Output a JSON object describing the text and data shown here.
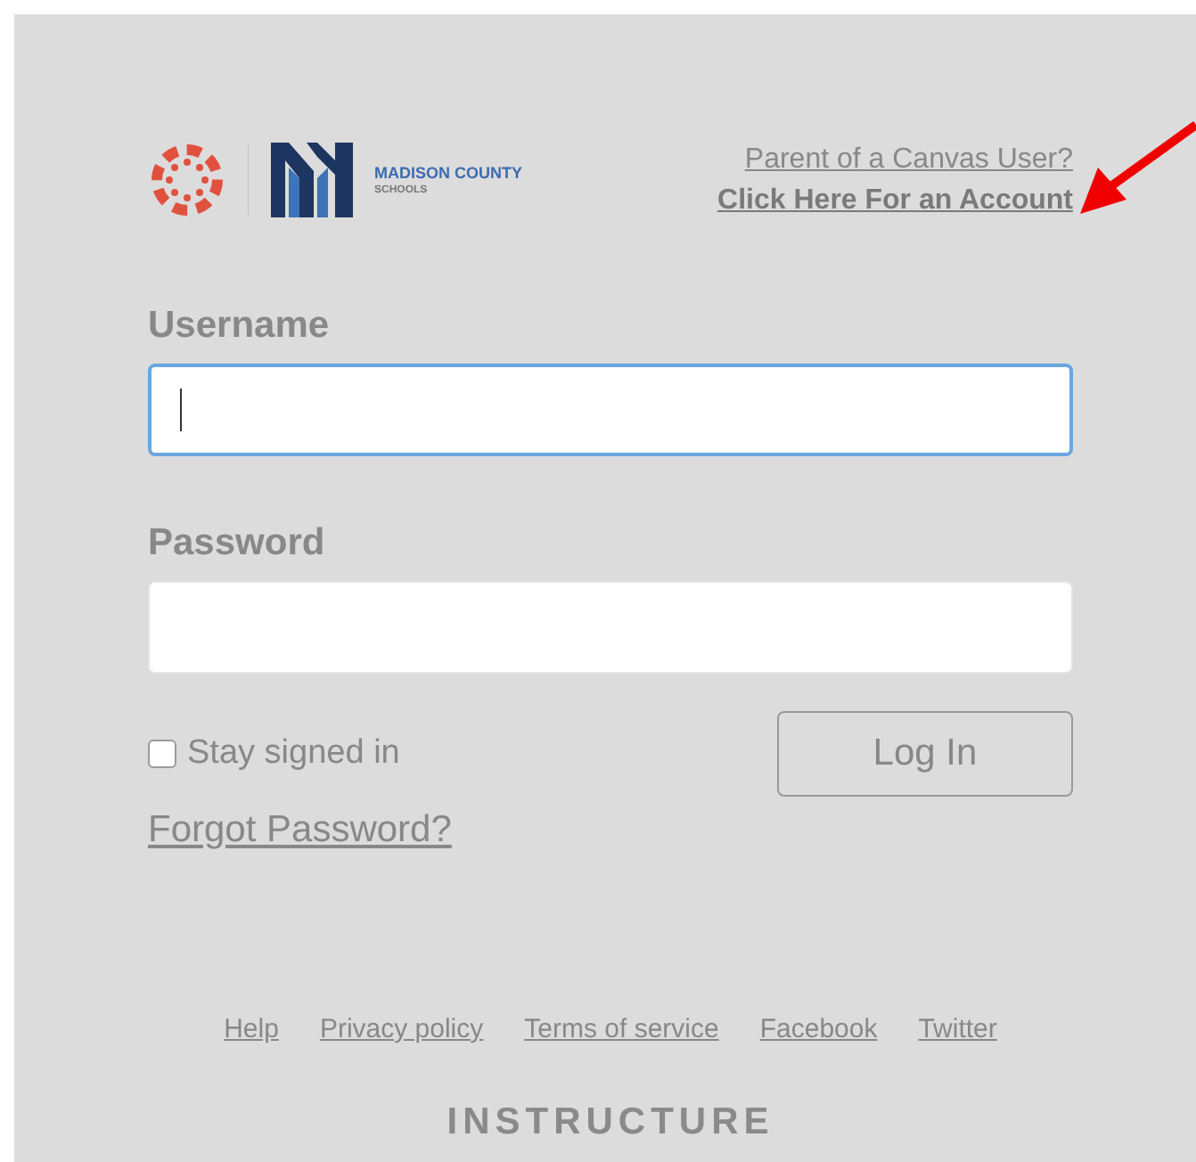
{
  "header": {
    "logo_title": "MADISON COUNTY",
    "logo_subtitle": "SCHOOLS",
    "parent_link_line1": "Parent of a Canvas User?",
    "parent_link_line2": "Click Here For an Account"
  },
  "fields": [
    {
      "label": "Username",
      "focused": true
    },
    {
      "label": "Password",
      "focused": false
    }
  ],
  "stay_signed_in": {
    "label": "Stay signed in",
    "checked": false
  },
  "forgot_link": "Forgot Password?",
  "login_button": "Log In",
  "footer_links": [
    "Help",
    "Privacy policy",
    "Terms of service",
    "Facebook",
    "Twitter"
  ],
  "brand": "INSTRUCTURE"
}
